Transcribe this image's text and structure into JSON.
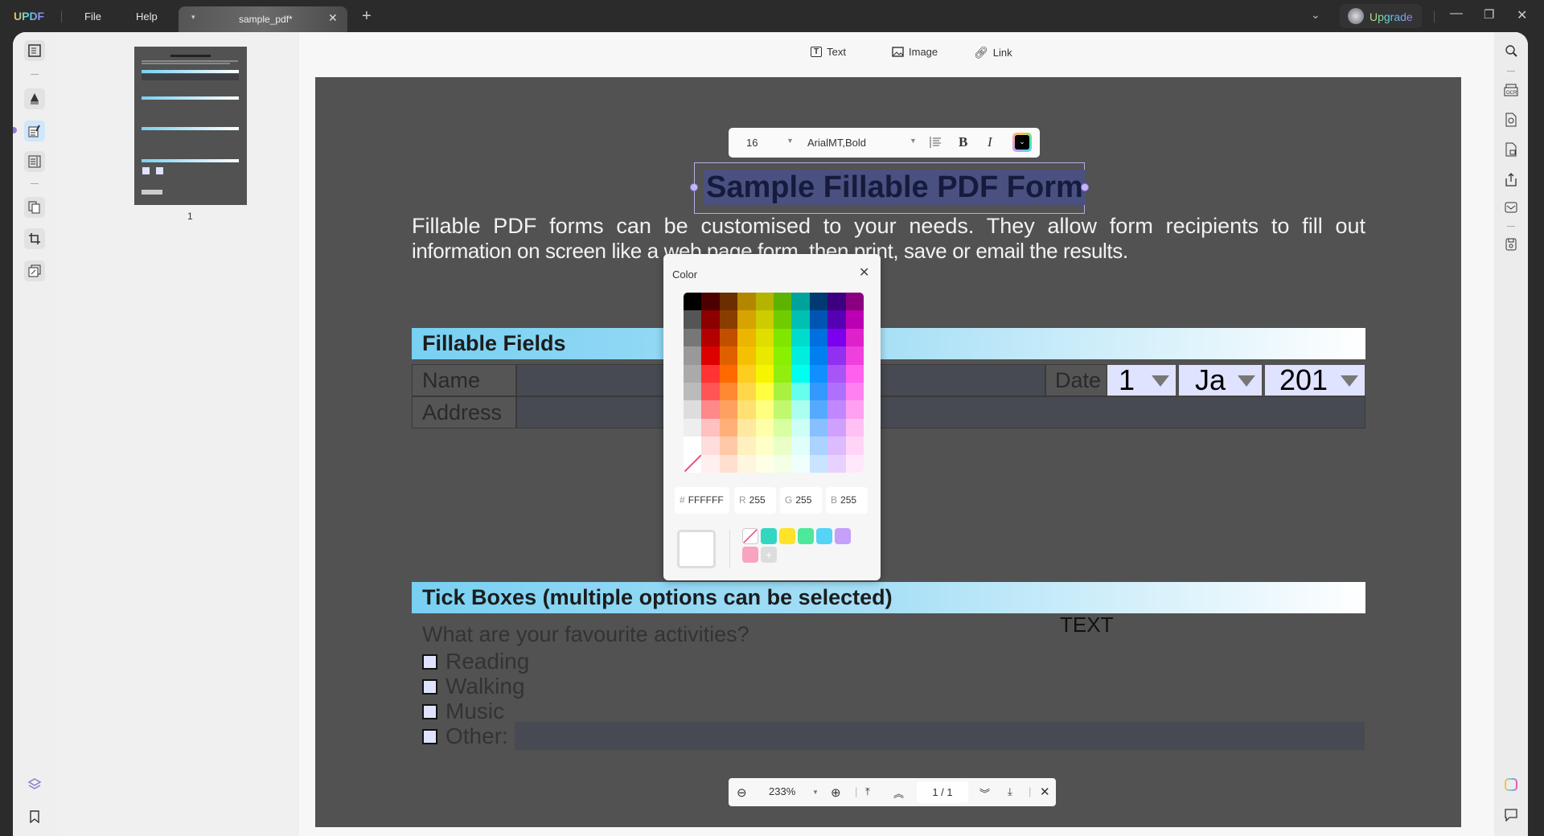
{
  "app": {
    "logo": "UPDF",
    "menu": [
      "File",
      "Help"
    ],
    "tab_title": "sample_pdf*",
    "upgrade": "Upgrade"
  },
  "topbar": {
    "text": "Text",
    "image": "Image",
    "link": "Link"
  },
  "thumbnail": {
    "page_label": "1"
  },
  "format_toolbar": {
    "font_size": "16",
    "font_name": "ArialMT,Bold",
    "current_color": "#000000"
  },
  "document": {
    "title": "Sample Fillable PDF Form",
    "paragraph_line1": "Fillable PDF forms can be customised to your needs. They allow form recipients to fill out",
    "paragraph_line2": "information on screen like a web page form, then print, save or email the results.",
    "section1": "Fillable Fields",
    "name_label": "Name",
    "address_label": "Address",
    "date_label": "Date",
    "date_day": "1",
    "date_month": "Jan",
    "date_year": "201",
    "section2": "Tick Boxes (multiple options can be selected)",
    "question": "What are your favourite activities?",
    "text_annotation": "TEXT",
    "options": [
      "Reading",
      "Walking",
      "Music",
      "Other:"
    ]
  },
  "color_popup": {
    "title": "Color",
    "hex_prefix": "#",
    "hex": "FFFFFF",
    "r_label": "R",
    "r": "255",
    "g_label": "G",
    "g": "255",
    "b_label": "B",
    "b": "255",
    "palette": [
      [
        "#000000",
        "#4d0000",
        "#6b2e00",
        "#b38600",
        "#b3b300",
        "#5cb300",
        "#00a399",
        "#003a70",
        "#3d0080",
        "#8a0080"
      ],
      [
        "#555555",
        "#8c0000",
        "#8a3d00",
        "#d6a300",
        "#cccc00",
        "#70cc00",
        "#00bfb3",
        "#0055b3",
        "#5500b3",
        "#bb00b3"
      ],
      [
        "#777777",
        "#b30000",
        "#c24e00",
        "#ebb500",
        "#dede00",
        "#80e600",
        "#00dccc",
        "#0070e0",
        "#7a00ee",
        "#dd22cc"
      ],
      [
        "#999999",
        "#dd0000",
        "#e06000",
        "#f5c000",
        "#e8e800",
        "#88f000",
        "#00eee0",
        "#0080f0",
        "#9030f0",
        "#ee40dd"
      ],
      [
        "#aaaaaa",
        "#ff3333",
        "#ff6a00",
        "#ffcc20",
        "#f5f500",
        "#90ee10",
        "#00ffee",
        "#1090ff",
        "#a855f7",
        "#ff60ee"
      ],
      [
        "#bbbbbb",
        "#ff5555",
        "#ff8833",
        "#ffd84a",
        "#ffff40",
        "#aaf040",
        "#66ffee",
        "#3399ff",
        "#b070ff",
        "#ff80f0"
      ],
      [
        "#dddddd",
        "#ff8888",
        "#ffa060",
        "#ffe070",
        "#ffff80",
        "#c0f870",
        "#aaffee",
        "#55aaff",
        "#c088ff",
        "#ffa0f0"
      ],
      [
        "#eeeeee",
        "#ffc0c0",
        "#ffb078",
        "#ffe8a0",
        "#ffffaa",
        "#d8ffa0",
        "#ccfff6",
        "#88c0ff",
        "#d0a0ff",
        "#ffc0f4"
      ],
      [
        "#ffffff",
        "#ffdddd",
        "#ffc8a8",
        "#fff0c0",
        "#ffffc8",
        "#eaffc8",
        "#e0fffa",
        "#aad4ff",
        "#ddbbff",
        "#ffd4f6"
      ],
      [
        "none",
        "#fff0f0",
        "#ffe0d0",
        "#fff6e0",
        "#ffffe6",
        "#f4ffe6",
        "#f0fffc",
        "#c8e4ff",
        "#e8d0ff",
        "#ffe8fa"
      ]
    ],
    "recent": [
      "none",
      "#33d6c0",
      "#ffe229",
      "#4ee89a",
      "#55d4f6",
      "#c4a0f8",
      "#f9a3c0"
    ],
    "selected": "#FFFFFF"
  },
  "zoombar": {
    "zoom": "233%",
    "page": "1 / 1"
  }
}
